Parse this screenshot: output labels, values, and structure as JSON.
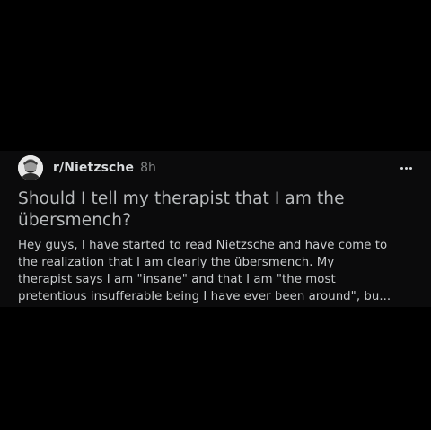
{
  "post": {
    "subreddit": "r/Nietzsche",
    "age": "8h",
    "title": "Should I tell my therapist that I am the übersmench?",
    "body_lines": [
      "Hey guys, I have started to read Nietzsche and have come to",
      "the realization that I am clearly the übersmench. My",
      "therapist says I am \"insane\" and that I am \"the most",
      "pretentious insufferable being I have ever been around\", bu..."
    ]
  },
  "icons": {
    "avatar": "nietzsche-portrait-avatar",
    "more": "more-options-icon"
  },
  "colors": {
    "background": "#000000",
    "card": "#0b0b0c",
    "title": "#b8bbbd",
    "body": "#c8cbcd",
    "meta": "#818384"
  }
}
